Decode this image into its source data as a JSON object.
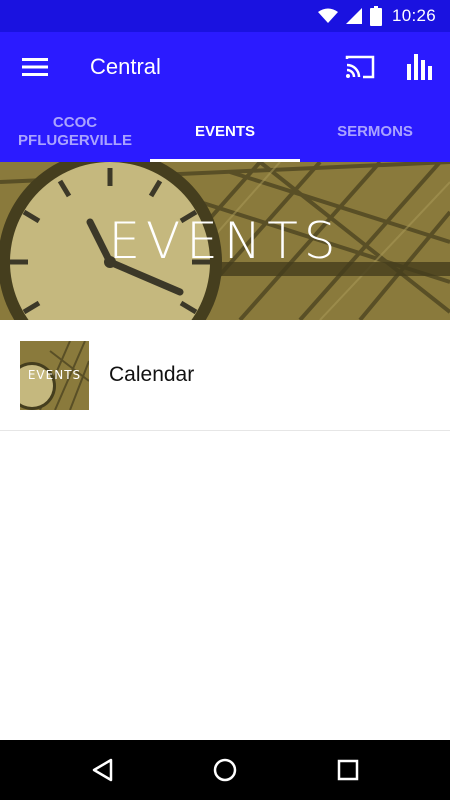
{
  "status_bar": {
    "time": "10:26",
    "icons": [
      "wifi-icon",
      "cell-signal-icon",
      "battery-icon"
    ]
  },
  "app_bar": {
    "title": "Central",
    "icons": [
      "menu-icon",
      "cast-icon",
      "bar-chart-icon"
    ],
    "background": "#2b1bff"
  },
  "tabs": [
    {
      "label": "CCOC PFLUGERVILLE",
      "active": false
    },
    {
      "label": "EVENTS",
      "active": true
    },
    {
      "label": "SERMONS",
      "active": false
    }
  ],
  "hero": {
    "title": "EVENTS"
  },
  "list": {
    "items": [
      {
        "label": "Calendar",
        "thumb_text": "EVENTS"
      }
    ]
  },
  "nav_bar": {
    "icons": [
      "back-icon",
      "home-icon",
      "recents-icon"
    ]
  }
}
